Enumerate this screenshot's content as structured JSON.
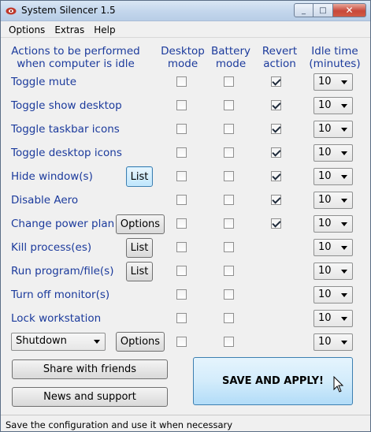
{
  "window": {
    "title": "System Silencer 1.5",
    "close_glyph": "✕",
    "minimize_glyph": "_",
    "maximize_glyph": "□"
  },
  "menu": [
    "Options",
    "Extras",
    "Help"
  ],
  "headers": {
    "actions_line1": "Actions to be performed",
    "actions_line2": "when computer is idle",
    "desktop_line1": "Desktop",
    "desktop_line2": "mode",
    "battery_line1": "Battery",
    "battery_line2": "mode",
    "revert_line1": "Revert",
    "revert_line2": "action",
    "idle_line1": "Idle time",
    "idle_line2": "(minutes)"
  },
  "rows": [
    {
      "label": "Toggle mute",
      "desktop": false,
      "battery": false,
      "revert": true,
      "idle": "10"
    },
    {
      "label": "Toggle show desktop",
      "desktop": false,
      "battery": false,
      "revert": true,
      "idle": "10"
    },
    {
      "label": "Toggle taskbar icons",
      "desktop": false,
      "battery": false,
      "revert": true,
      "idle": "10"
    },
    {
      "label": "Toggle desktop icons",
      "desktop": false,
      "battery": false,
      "revert": true,
      "idle": "10"
    },
    {
      "label": "Hide window(s)",
      "desktop": false,
      "battery": false,
      "revert": true,
      "idle": "10",
      "button": "List"
    },
    {
      "label": "Disable Aero",
      "desktop": false,
      "battery": false,
      "revert": true,
      "idle": "10"
    },
    {
      "label": "Change power plan",
      "desktop": false,
      "battery": false,
      "revert": true,
      "idle": "10",
      "button": "Options"
    },
    {
      "label": "Kill process(es)",
      "desktop": false,
      "battery": false,
      "idle": "10",
      "button": "List"
    },
    {
      "label": "Run program/file(s)",
      "desktop": false,
      "battery": false,
      "idle": "10",
      "button": "List"
    },
    {
      "label": "Turn off monitor(s)",
      "desktop": false,
      "battery": false,
      "idle": "10"
    },
    {
      "label": "Lock workstation",
      "desktop": false,
      "battery": false,
      "idle": "10"
    },
    {
      "dropdown": "Shutdown",
      "desktop": false,
      "battery": false,
      "idle": "10",
      "button": "Options"
    }
  ],
  "buttons": {
    "share": "Share with friends",
    "news": "News and support",
    "save": "SAVE AND APPLY!"
  },
  "status": "Save the configuration and use it when necessary",
  "colors": {
    "label": "#1b3a9c",
    "accent": "#3c7fb1"
  }
}
